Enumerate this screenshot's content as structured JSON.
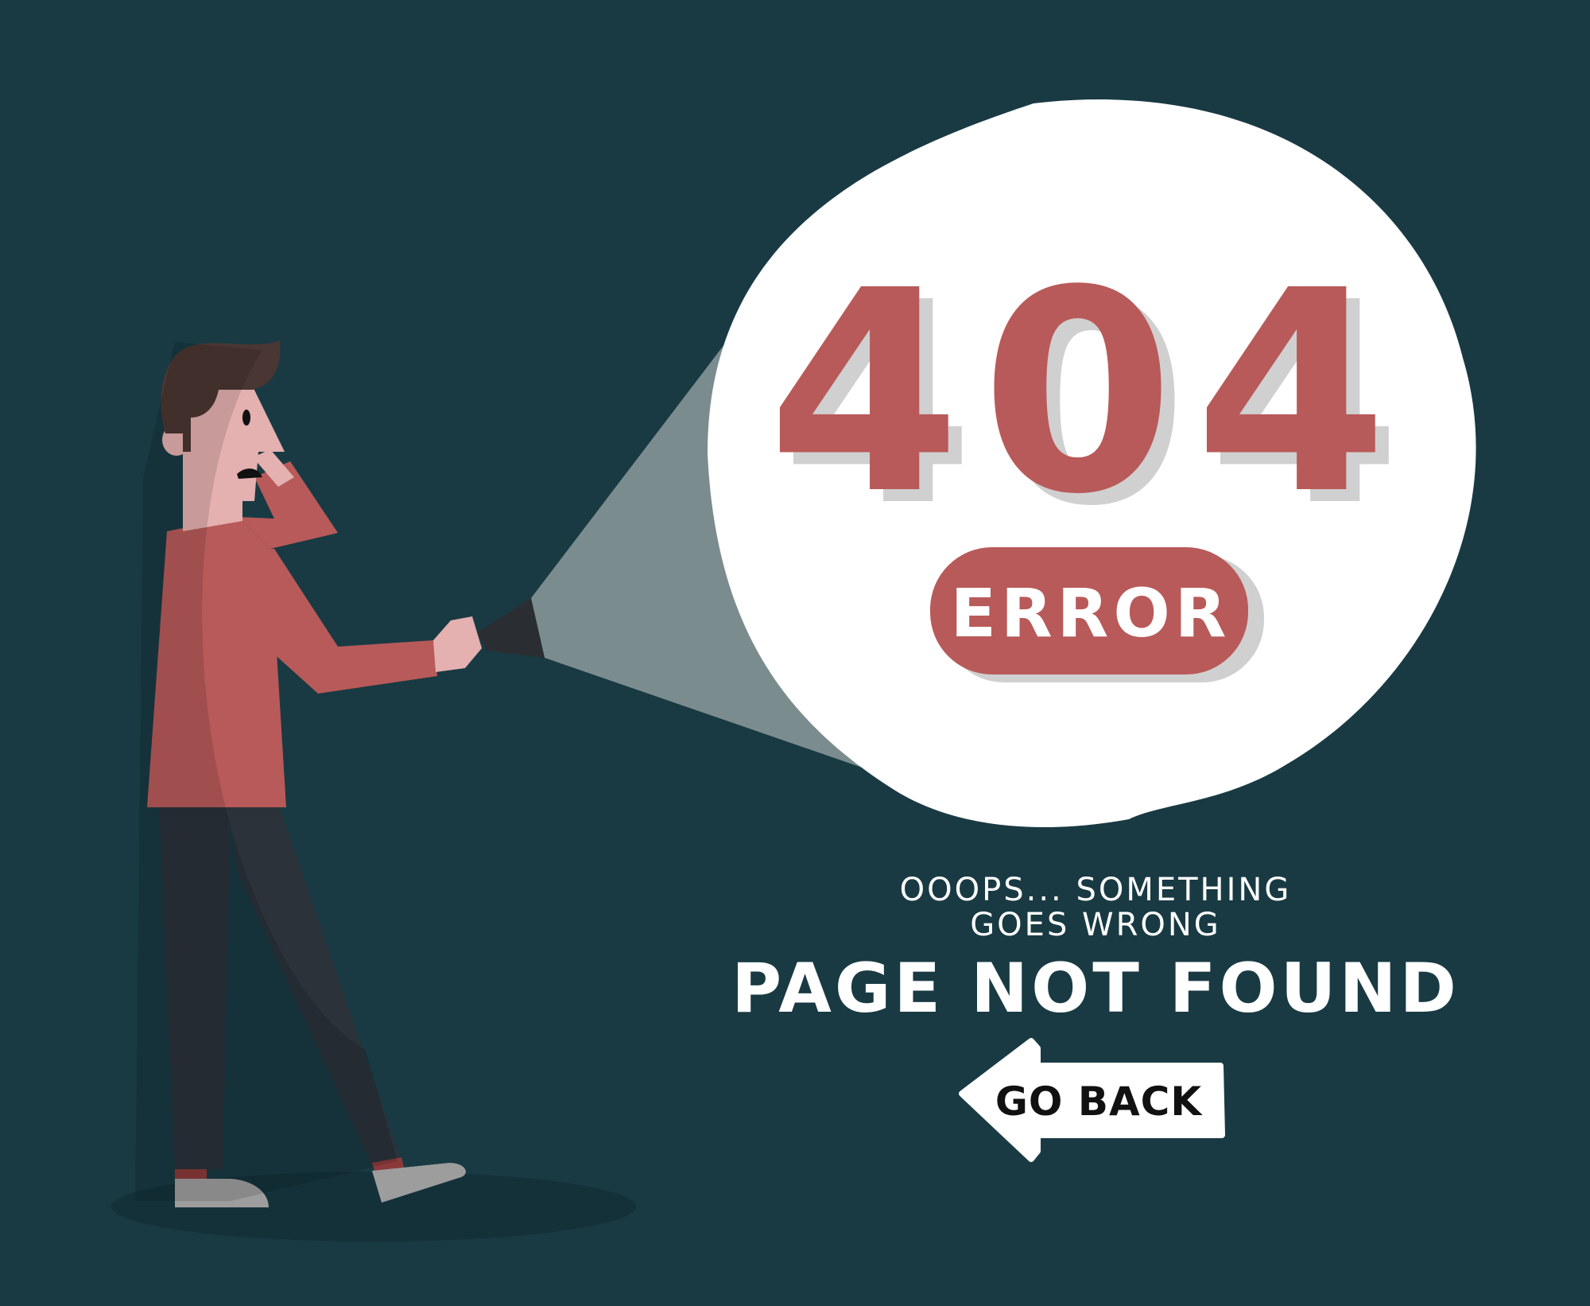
{
  "error": {
    "code": "404",
    "badge": "ERROR"
  },
  "message": {
    "line1": "OOOPS... SOMETHING",
    "line2": "GOES WRONG",
    "heading": "PAGE NOT FOUND"
  },
  "back_button": {
    "label": "GO BACK",
    "icon": "arrow-left-icon"
  },
  "illustration": {
    "subject": "person-with-flashlight"
  },
  "colors": {
    "background": "#193a43",
    "accent": "#b85a59",
    "spotlight": "#ffffff",
    "text": "#ffffff",
    "shadow": "#d0d0d0",
    "button_text": "#111111"
  }
}
